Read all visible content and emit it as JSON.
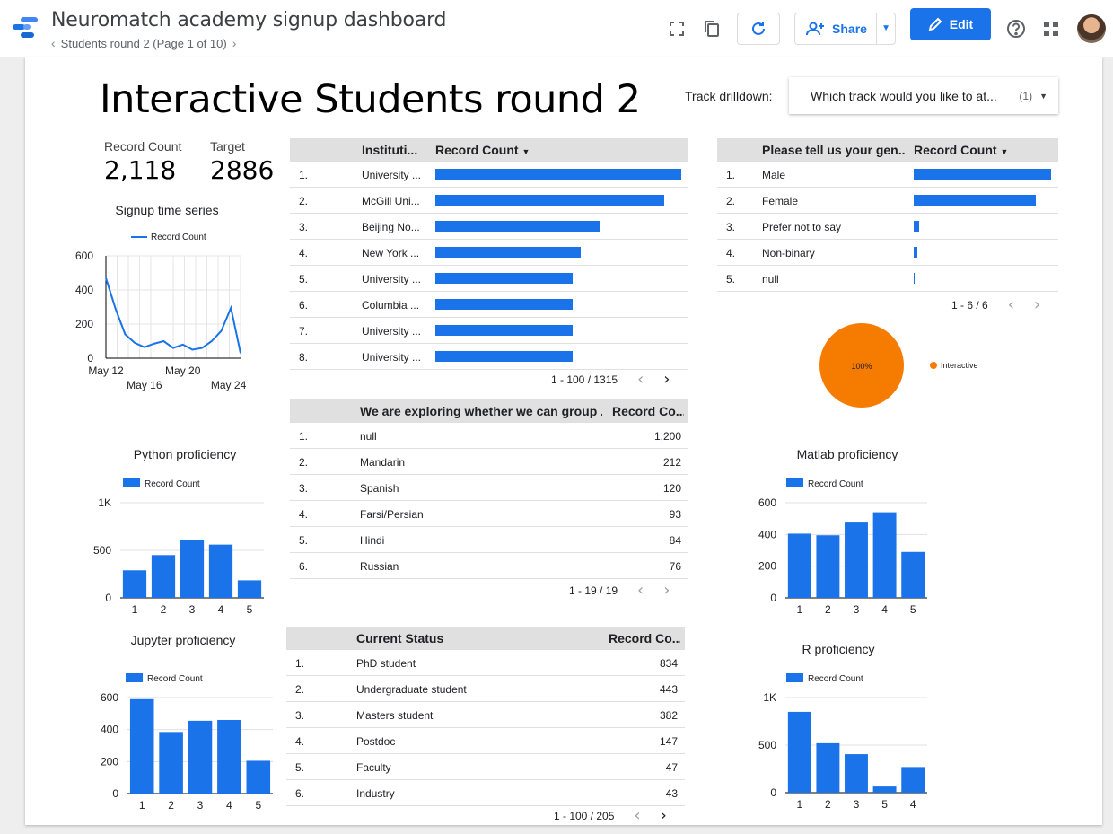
{
  "header": {
    "title": "Neuromatch academy signup dashboard",
    "page_label": "Students round 2 (Page 1 of 10)",
    "share_label": "Share",
    "edit_label": "Edit",
    "brand_color": "#1a73e8"
  },
  "report": {
    "title": "Interactive Students round 2",
    "drilldown_label": "Track drilldown:",
    "drilldown_value": "Which track would you like to at...",
    "drilldown_count": "(1)"
  },
  "scorecards": [
    {
      "label": "Record Count",
      "value": "2,118"
    },
    {
      "label": "Target",
      "value": "2886"
    }
  ],
  "institutions_table": {
    "headers": [
      "Instituti...",
      "Record Count"
    ],
    "rows": [
      {
        "num": "1.",
        "name": "University ...",
        "value": 1
      },
      {
        "num": "2.",
        "name": "McGill Uni...",
        "value": 0.93
      },
      {
        "num": "3.",
        "name": "Beijing No...",
        "value": 0.67
      },
      {
        "num": "4.",
        "name": "New York ...",
        "value": 0.59
      },
      {
        "num": "5.",
        "name": "University ...",
        "value": 0.56
      },
      {
        "num": "6.",
        "name": "Columbia ...",
        "value": 0.56
      },
      {
        "num": "7.",
        "name": "University ...",
        "value": 0.56
      },
      {
        "num": "8.",
        "name": "University ...",
        "value": 0.56
      }
    ],
    "pager": "1 - 100 / 1315"
  },
  "gender_table": {
    "headers": [
      "Please tell us your gen...",
      "Record Count"
    ],
    "rows": [
      {
        "num": "1.",
        "name": "Male",
        "value": 1
      },
      {
        "num": "2.",
        "name": "Female",
        "value": 0.89
      },
      {
        "num": "3.",
        "name": "Prefer not to say",
        "value": 0.04
      },
      {
        "num": "4.",
        "name": "Non-binary",
        "value": 0.025
      },
      {
        "num": "5.",
        "name": "null",
        "value": 0.005
      }
    ],
    "pager": "1 - 6 / 6"
  },
  "language_table": {
    "headers": [
      "We are exploring whether we can group ...",
      "Record Co..."
    ],
    "rows": [
      {
        "num": "1.",
        "name": "null",
        "value": "1,200"
      },
      {
        "num": "2.",
        "name": "Mandarin",
        "value": "212"
      },
      {
        "num": "3.",
        "name": "Spanish",
        "value": "120"
      },
      {
        "num": "4.",
        "name": "Farsi/Persian",
        "value": "93"
      },
      {
        "num": "5.",
        "name": "Hindi",
        "value": "84"
      },
      {
        "num": "6.",
        "name": "Russian",
        "value": "76"
      }
    ],
    "pager": "1 - 19 / 19"
  },
  "status_table": {
    "headers": [
      "Current Status",
      "Record Co..."
    ],
    "rows": [
      {
        "num": "1.",
        "name": "PhD student",
        "value": "834"
      },
      {
        "num": "2.",
        "name": "Undergraduate student",
        "value": "443"
      },
      {
        "num": "3.",
        "name": "Masters student",
        "value": "382"
      },
      {
        "num": "4.",
        "name": "Postdoc",
        "value": "147"
      },
      {
        "num": "5.",
        "name": "Faculty",
        "value": "47"
      },
      {
        "num": "6.",
        "name": "Industry",
        "value": "43"
      }
    ],
    "pager": "1 - 100 / 205"
  },
  "chart_data": [
    {
      "id": "signup",
      "type": "line",
      "title": "Signup time series",
      "legend": "Record Count",
      "x_tick_labels": [
        "May 12",
        "May 16",
        "May 20",
        "May 24"
      ],
      "y_ticks": [
        "0",
        "200",
        "400",
        "600"
      ],
      "ylim": [
        0,
        600
      ],
      "values": [
        470,
        290,
        140,
        90,
        65,
        85,
        100,
        60,
        80,
        50,
        60,
        100,
        160,
        295,
        30
      ],
      "color": "#1a73e8"
    },
    {
      "id": "python",
      "type": "bar",
      "title": "Python proficiency",
      "legend": "Record Count",
      "categories": [
        "1",
        "2",
        "3",
        "4",
        "5"
      ],
      "values": [
        290,
        450,
        610,
        560,
        185
      ],
      "y_ticks": [
        "0",
        "500",
        "1K"
      ],
      "ylim": [
        0,
        1000
      ],
      "color": "#1a73e8"
    },
    {
      "id": "jupyter",
      "type": "bar",
      "title": "Jupyter proficiency",
      "legend": "Record Count",
      "categories": [
        "1",
        "2",
        "3",
        "4",
        "5"
      ],
      "values": [
        590,
        385,
        455,
        460,
        205
      ],
      "y_ticks": [
        "0",
        "200",
        "400",
        "600"
      ],
      "ylim": [
        0,
        600
      ],
      "color": "#1a73e8"
    },
    {
      "id": "matlab",
      "type": "bar",
      "title": "Matlab proficiency",
      "legend": "Record Count",
      "categories": [
        "1",
        "2",
        "3",
        "4",
        "5"
      ],
      "values": [
        405,
        395,
        475,
        540,
        290
      ],
      "y_ticks": [
        "0",
        "200",
        "400",
        "600"
      ],
      "ylim": [
        0,
        600
      ],
      "color": "#1a73e8"
    },
    {
      "id": "rprof",
      "type": "bar",
      "title": "R proficiency",
      "legend": "Record Count",
      "categories": [
        "1",
        "2",
        "3",
        "5",
        "4"
      ],
      "values": [
        850,
        520,
        405,
        65,
        270
      ],
      "y_ticks": [
        "0",
        "500",
        "1K"
      ],
      "ylim": [
        0,
        1000
      ],
      "color": "#1a73e8"
    },
    {
      "id": "track_pie",
      "type": "pie",
      "slices": [
        {
          "label": "Interactive",
          "value": 100,
          "display": "100%"
        }
      ],
      "color": "#f57c00"
    }
  ]
}
